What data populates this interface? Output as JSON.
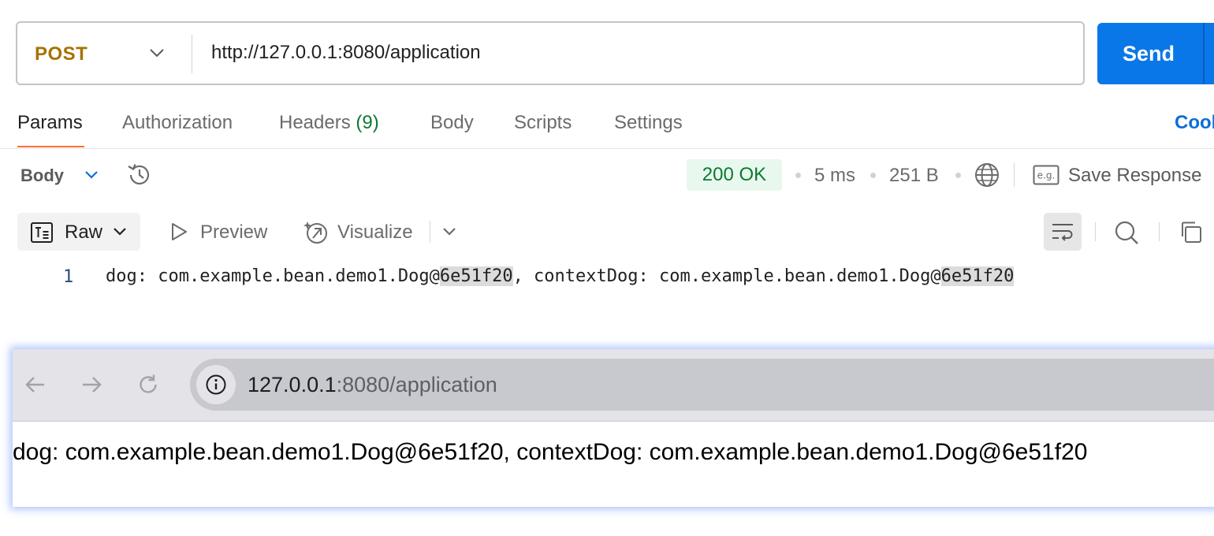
{
  "request": {
    "method": "POST",
    "url": "http://127.0.0.1:8080/application",
    "send_label": "Send"
  },
  "tabs": {
    "params": "Params",
    "authorization": "Authorization",
    "headers": "Headers",
    "headers_count": "(9)",
    "body": "Body",
    "scripts": "Scripts",
    "settings": "Settings",
    "cookies": "Cookies"
  },
  "response": {
    "body_label": "Body",
    "status": "200 OK",
    "time": "5 ms",
    "size": "251 B",
    "save_response": "Save Response",
    "eg_icon_text": "e.g."
  },
  "toolbar": {
    "raw": "Raw",
    "preview": "Preview",
    "visualize": "Visualize"
  },
  "code": {
    "line_number": "1",
    "dog_prefix": "dog: com.example.bean.demo1.Dog@",
    "dog_hash": "6e51f20",
    "context_prefix": ", contextDog: com.example.bean.demo1.Dog@",
    "context_hash": "6e51f20"
  },
  "browser": {
    "host": "127.0.0.1",
    "path": ":8080/application",
    "page_text": "dog: com.example.bean.demo1.Dog@6e51f20, contextDog: com.example.bean.demo1.Dog@6e51f20"
  },
  "colors": {
    "accent": "#0a77e8",
    "method": "#a57300",
    "status_ok": "#0b7a32",
    "tab_underline": "#ff6c37"
  }
}
